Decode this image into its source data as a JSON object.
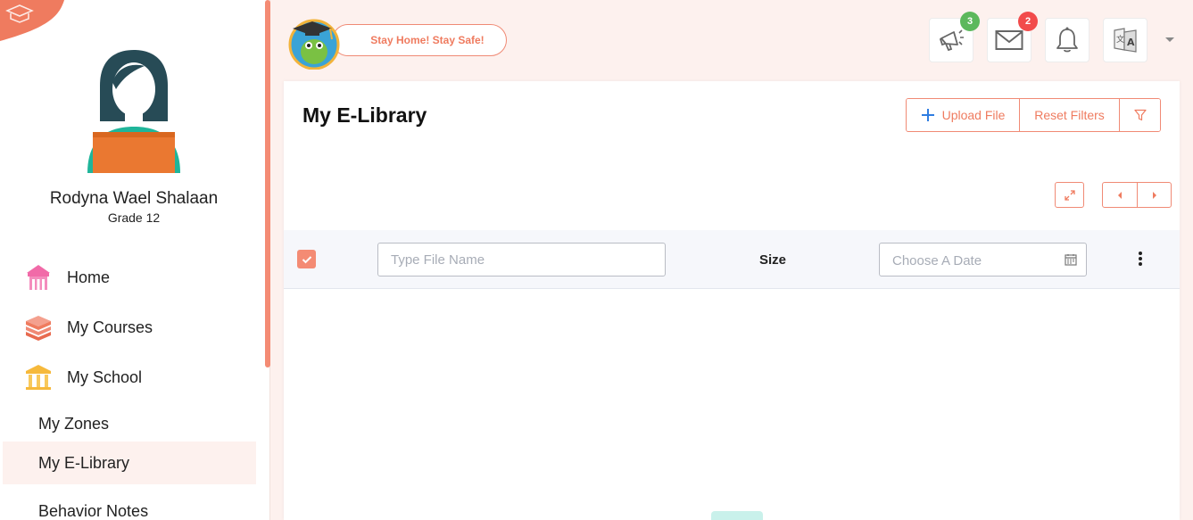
{
  "user": {
    "name": "Rodyna Wael Shalaan",
    "grade": "Grade 12"
  },
  "nav": {
    "items": [
      {
        "label": "Home",
        "icon": "school-building-icon"
      },
      {
        "label": "My Courses",
        "icon": "books-icon"
      },
      {
        "label": "My School",
        "icon": "institution-icon"
      }
    ],
    "subitems": [
      {
        "label": "My Zones"
      },
      {
        "label": "My E-Library",
        "active": true
      },
      {
        "label": "Behavior Notes"
      }
    ]
  },
  "header": {
    "banner": "Stay Home! Stay Safe!",
    "announcements_count": "3",
    "messages_count": "2",
    "icons": [
      "megaphone-icon",
      "envelope-icon",
      "bell-icon",
      "translate-icon",
      "chevron-down-icon"
    ]
  },
  "page": {
    "title": "My E-Library",
    "upload_label": "Upload File",
    "reset_label": "Reset Filters"
  },
  "filters": {
    "file_name_placeholder": "Type File Name",
    "size_header": "Size",
    "date_placeholder": "Choose A Date",
    "select_all_checked": true
  },
  "colors": {
    "accent": "#f08a75",
    "background": "#fdf1ee",
    "badge_green": "#5cb85c",
    "badge_red": "#f24b4b"
  }
}
